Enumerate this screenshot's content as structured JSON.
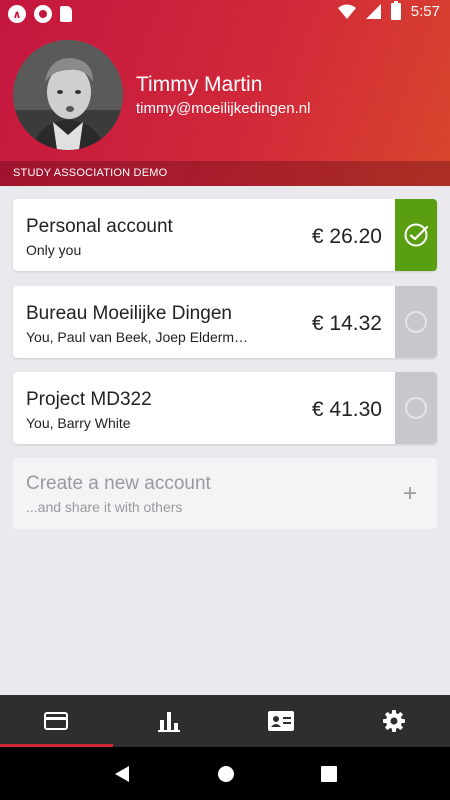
{
  "status_bar": {
    "time": "5:57"
  },
  "profile": {
    "name": "Timmy Martin",
    "email": "timmy@moeilijkedingen.nl"
  },
  "organization": {
    "label": "STUDY ASSOCIATION DEMO"
  },
  "accounts": [
    {
      "title": "Personal account",
      "members": "Only you",
      "balance": "€ 26.20",
      "selected": true
    },
    {
      "title": "Bureau Moeilijke Dingen",
      "members": "You, Paul van Beek, Joep Elderm…",
      "balance": "€ 14.32",
      "selected": false
    },
    {
      "title": "Project MD322",
      "members": "You, Barry White",
      "balance": "€ 41.30",
      "selected": false
    }
  ],
  "create_account": {
    "title": "Create a new account",
    "subtitle": "...and share it with others",
    "icon": "plus-icon"
  },
  "tabs": [
    {
      "icon": "card-icon",
      "active": true
    },
    {
      "icon": "bar-chart-icon",
      "active": false
    },
    {
      "icon": "id-card-icon",
      "active": false
    },
    {
      "icon": "gear-icon",
      "active": false
    }
  ],
  "colors": {
    "header_start": "#c4163f",
    "header_end": "#d9452c",
    "selected_green": "#5a9e12",
    "tab_indicator": "#d1283a"
  }
}
